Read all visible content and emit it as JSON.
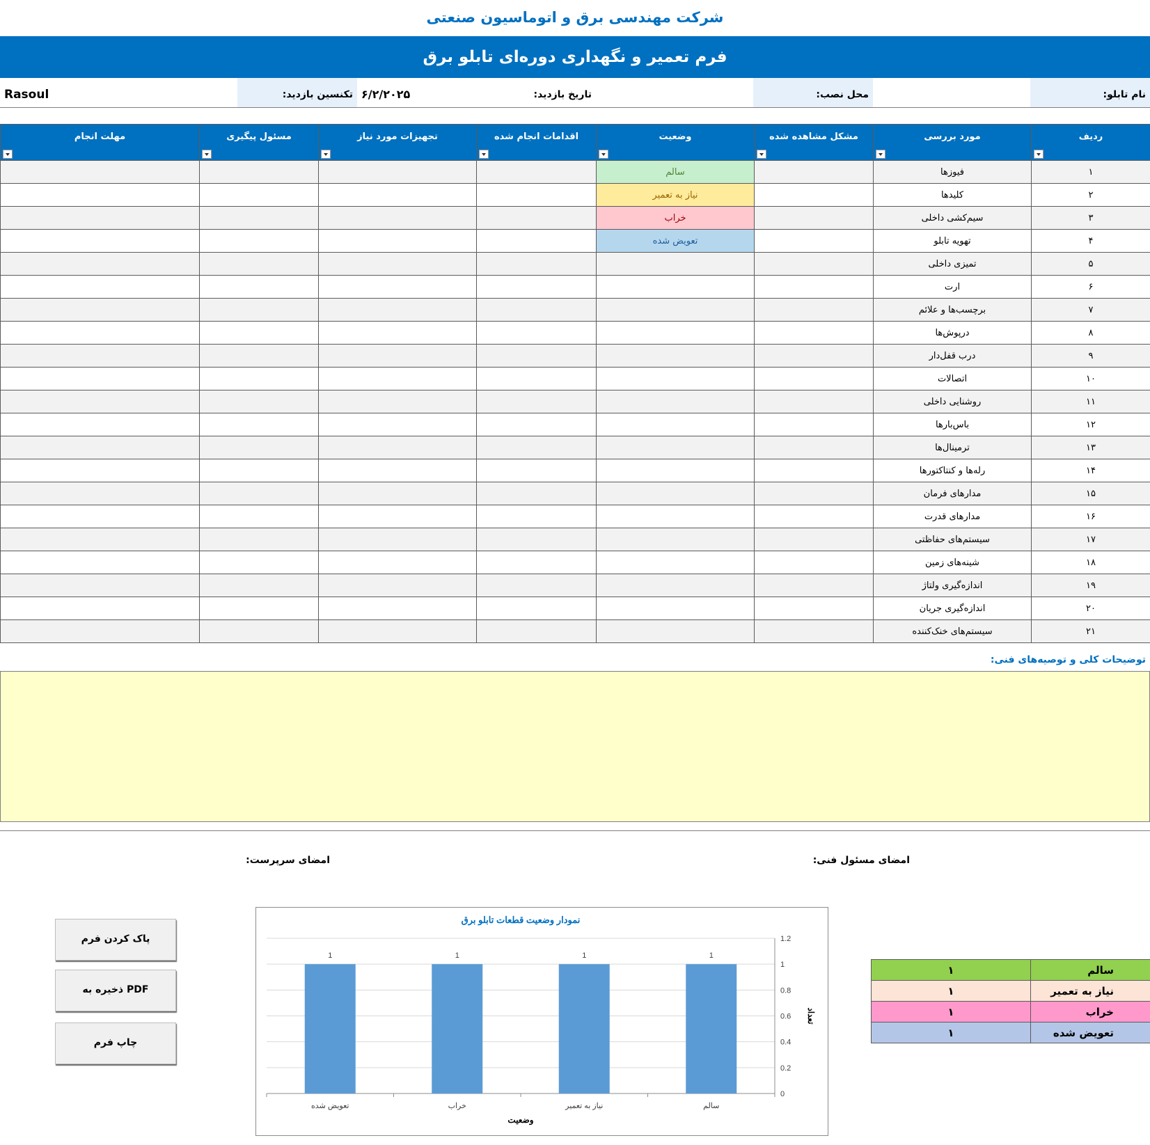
{
  "header": {
    "company": "شرکت مهندسی برق و اتوماسیون صنعتی",
    "form_title": "فرم تعمیر و نگهداری دوره‌ای تابلو برق"
  },
  "info": {
    "panel_name_label": "نام تابلو:",
    "panel_name_value": "",
    "location_label": "محل نصب:",
    "location_value": "",
    "date_label": "تاریخ بازدید:",
    "date_value": "۶/۲/۲۰۲۵",
    "technician_label": "تکنسین بازدید:",
    "technician_value": "Rasoul"
  },
  "table": {
    "headers": [
      "ردیف",
      "مورد بررسی",
      "مشکل مشاهده شده",
      "وضعیت",
      "اقدامات انجام شده",
      "تجهیزات مورد نیاز",
      "مسئول پیگیری",
      "مهلت انجام"
    ],
    "rows": [
      {
        "num": "۱",
        "item": "فیوزها",
        "status": "سالم"
      },
      {
        "num": "۲",
        "item": "کلیدها",
        "status": "نیاز به تعمیر"
      },
      {
        "num": "۳",
        "item": "سیم‌کشی داخلی",
        "status": "خراب"
      },
      {
        "num": "۴",
        "item": "تهویه تابلو",
        "status": "تعویض شده"
      },
      {
        "num": "۵",
        "item": "تمیزی داخلی",
        "status": ""
      },
      {
        "num": "۶",
        "item": "ارت",
        "status": ""
      },
      {
        "num": "۷",
        "item": "برچسب‌ها و علائم",
        "status": ""
      },
      {
        "num": "۸",
        "item": "درپوش‌ها",
        "status": ""
      },
      {
        "num": "۹",
        "item": "درب قفل‌دار",
        "status": ""
      },
      {
        "num": "۱۰",
        "item": "اتصالات",
        "status": ""
      },
      {
        "num": "۱۱",
        "item": "روشنایی داخلی",
        "status": ""
      },
      {
        "num": "۱۲",
        "item": "باس‌بارها",
        "status": ""
      },
      {
        "num": "۱۳",
        "item": "ترمینال‌ها",
        "status": ""
      },
      {
        "num": "۱۴",
        "item": "رله‌ها و کنتاکتورها",
        "status": ""
      },
      {
        "num": "۱۵",
        "item": "مدارهای فرمان",
        "status": ""
      },
      {
        "num": "۱۶",
        "item": "مدارهای قدرت",
        "status": ""
      },
      {
        "num": "۱۷",
        "item": "سیستم‌های حفاظتی",
        "status": ""
      },
      {
        "num": "۱۸",
        "item": "شینه‌های زمین",
        "status": ""
      },
      {
        "num": "۱۹",
        "item": "اندازه‌گیری ولتاژ",
        "status": ""
      },
      {
        "num": "۲۰",
        "item": "اندازه‌گیری جریان",
        "status": ""
      },
      {
        "num": "۲۱",
        "item": "سیستم‌های خنک‌کننده",
        "status": ""
      }
    ]
  },
  "status_styles": {
    "سالم": {
      "bg": "#C6EFCE",
      "fg": "#548235"
    },
    "نیاز به تعمیر": {
      "bg": "#FFEB9C",
      "fg": "#9C6500"
    },
    "خراب": {
      "bg": "#FFC7CE",
      "fg": "#9C0006"
    },
    "تعویض شده": {
      "bg": "#B4D7EE",
      "fg": "#1F5C99"
    }
  },
  "notes": {
    "label": "توضیحات کلی و توصیه‌های فنی:",
    "text": ""
  },
  "signatures": {
    "technical": "امضای مسئول فنی:",
    "supervisor": "امضای سرپرست:"
  },
  "buttons": {
    "clear": "پاک کردن فرم",
    "save_pdf": "ذخیره به PDF",
    "print": "چاپ فرم"
  },
  "summary": [
    {
      "label": "سالم",
      "count": "۱",
      "color": "#92D050"
    },
    {
      "label": "نیاز به تعمیر",
      "count": "۱",
      "color": "#FCE4D6"
    },
    {
      "label": "خراب",
      "count": "۱",
      "color": "#FF99CC"
    },
    {
      "label": "تعویض شده",
      "count": "۱",
      "color": "#B4C6E7"
    }
  ],
  "chart_data": {
    "type": "bar",
    "title": "نمودار وضعیت قطعات تابلو برق",
    "categories": [
      "سالم",
      "نیاز به تعمیر",
      "خراب",
      "تعویض شده"
    ],
    "values": [
      1,
      1,
      1,
      1
    ],
    "xlabel": "وضعیت",
    "ylabel": "تعداد",
    "ylim": [
      0,
      1.2
    ],
    "yticks": [
      0,
      0.2,
      0.4,
      0.6,
      0.8,
      1,
      1.2
    ],
    "bar_color": "#5B9BD5",
    "y_axis_side": "right",
    "category_order": "right-to-left",
    "grid": true,
    "data_labels": true
  }
}
